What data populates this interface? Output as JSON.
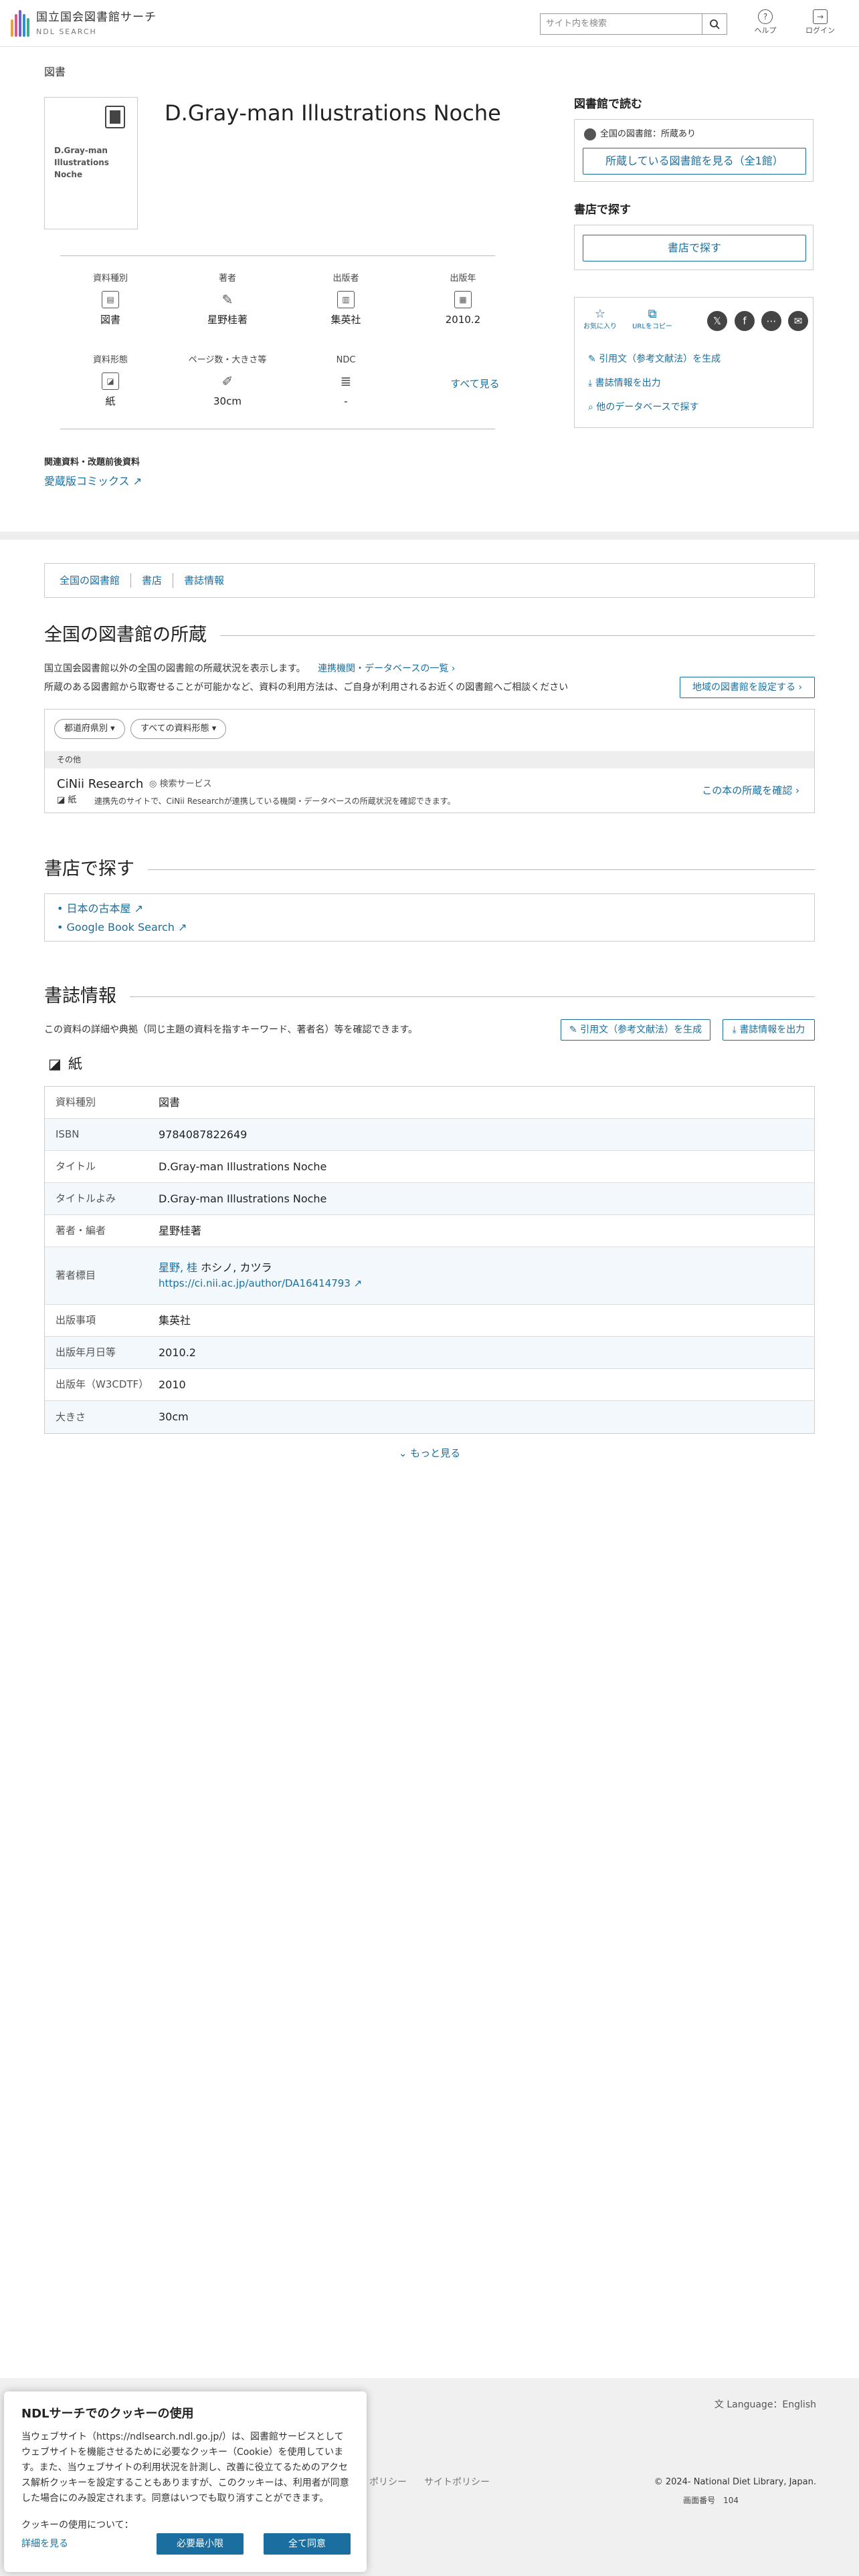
{
  "header": {
    "logo_title": "国立国会図書館サーチ",
    "logo_sub": "NDL SEARCH",
    "search_placeholder": "サイト内を検索",
    "help": "ヘルプ",
    "login": "ログイン"
  },
  "breadcrumb": "図書",
  "thumbnail_title": "D.Gray‐man Illustrations Noche",
  "title": "D.Gray‐man Illustrations Noche",
  "meta": [
    {
      "label": "資料種別",
      "value": "図書",
      "icon": "book-type-icon"
    },
    {
      "label": "著者",
      "value": "星野桂著",
      "icon": "pen-icon"
    },
    {
      "label": "出版者",
      "value": "集英社",
      "icon": "publisher-icon"
    },
    {
      "label": "出版年",
      "value": "2010.2",
      "icon": "calendar-icon"
    },
    {
      "label": "資料形態",
      "value": "紙",
      "icon": "paper-icon"
    },
    {
      "label": "ページ数・大きさ等",
      "value": "30cm",
      "icon": "ruler-icon"
    },
    {
      "label": "NDC",
      "value": "-",
      "icon": "ndc-icon"
    }
  ],
  "see_all": "すべて見る",
  "related_heading": "関連資料・改題前後資料",
  "related_link": "愛蔵版コミックス",
  "read_at_library": {
    "heading": "図書館で読む",
    "status": "全国の図書館：所蔵あり",
    "button": "所蔵している図書館を見る（全1館）"
  },
  "find_at_store": {
    "heading": "書店で探す",
    "button": "書店で探す"
  },
  "share": {
    "favorite": "お気に入り",
    "copy_url": "URLをコピー",
    "cite": "引用文（参考文献法）を生成",
    "export": "書誌情報を出力",
    "other_db": "他のデータベースで探す"
  },
  "tabs": [
    "全国の図書館",
    "書店",
    "書誌情報"
  ],
  "libraries": {
    "heading": "全国の図書館の所蔵",
    "desc1": "国立国会図書館以外の全国の図書館の所蔵状況を表示します。",
    "desc_link": "連携機関・データベースの一覧",
    "desc2": "所蔵のある図書館から取寄せることが可能かなど、資料の利用方法は、ご自身が利用されるお近くの図書館へご相談ください",
    "set_region": "地域の図書館を設定する",
    "filter_pref": "都道府県別",
    "filter_type": "すべての資料形態",
    "group": "その他",
    "source_name": "CiNii Research",
    "source_tag": "検索サービス",
    "source_kind": "紙",
    "source_desc": "連携先のサイトで、CiNii Researchが連携している機関・データベースの所蔵状況を確認できます。",
    "confirm": "この本の所蔵を確認"
  },
  "bookstores": {
    "heading": "書店で探す",
    "items": [
      "日本の古本屋",
      "Google Book Search"
    ]
  },
  "biblio": {
    "heading": "書誌情報",
    "desc": "この資料の詳細や典拠（同じ主題の資料を指すキーワード、著者名）等を確認できます。",
    "cite_button": "引用文（参考文献法）を生成",
    "export_button": "書誌情報を出力",
    "kind": "紙",
    "rows": [
      {
        "k": "資料種別",
        "v": "図書"
      },
      {
        "k": "ISBN",
        "v": "9784087822649"
      },
      {
        "k": "タイトル",
        "v": "D.Gray‐man Illustrations Noche"
      },
      {
        "k": "タイトルよみ",
        "v": "D.Gray‐man Illustrations Noche"
      },
      {
        "k": "著者・編者",
        "v": "星野桂著"
      },
      {
        "k": "著者標目",
        "v": "星野, 桂",
        "v2": "ホシノ, カツラ",
        "v3": "https://ci.nii.ac.jp/author/DA16414793"
      },
      {
        "k": "出版事項",
        "v": "集英社"
      },
      {
        "k": "出版年月日等",
        "v": "2010.2"
      },
      {
        "k": "出版年（W3CDTF）",
        "v": "2010"
      },
      {
        "k": "大きさ",
        "v": "30cm"
      }
    ],
    "more": "もっと見る"
  },
  "footer": {
    "language": "Language：English",
    "link1": "ポリシー",
    "link2": "サイトポリシー",
    "copyright": "© 2024- National Diet Library, Japan.",
    "page_no_label": "画面番号",
    "page_no": "104"
  },
  "cookie": {
    "title": "NDLサーチでのクッキーの使用",
    "body": "当ウェブサイト（https://ndlsearch.ndl.go.jp/）は、図書館サービスとしてウェブサイトを機能させるために必要なクッキー（Cookie）を使用しています。また、当ウェブサイトの利用状況を計測し、改善に役立てるためのアクセス解析クッキーを設定することもありますが、このクッキーは、利用者が同意した場合にのみ設定されます。同意はいつでも取り消すことができます。",
    "question": "クッキーの使用について：",
    "details": "詳細を見る",
    "necessary": "必要最小限",
    "accept_all": "全て同意"
  },
  "colors": {
    "accent": "#1a6fa0",
    "band": "#eeeeee"
  }
}
